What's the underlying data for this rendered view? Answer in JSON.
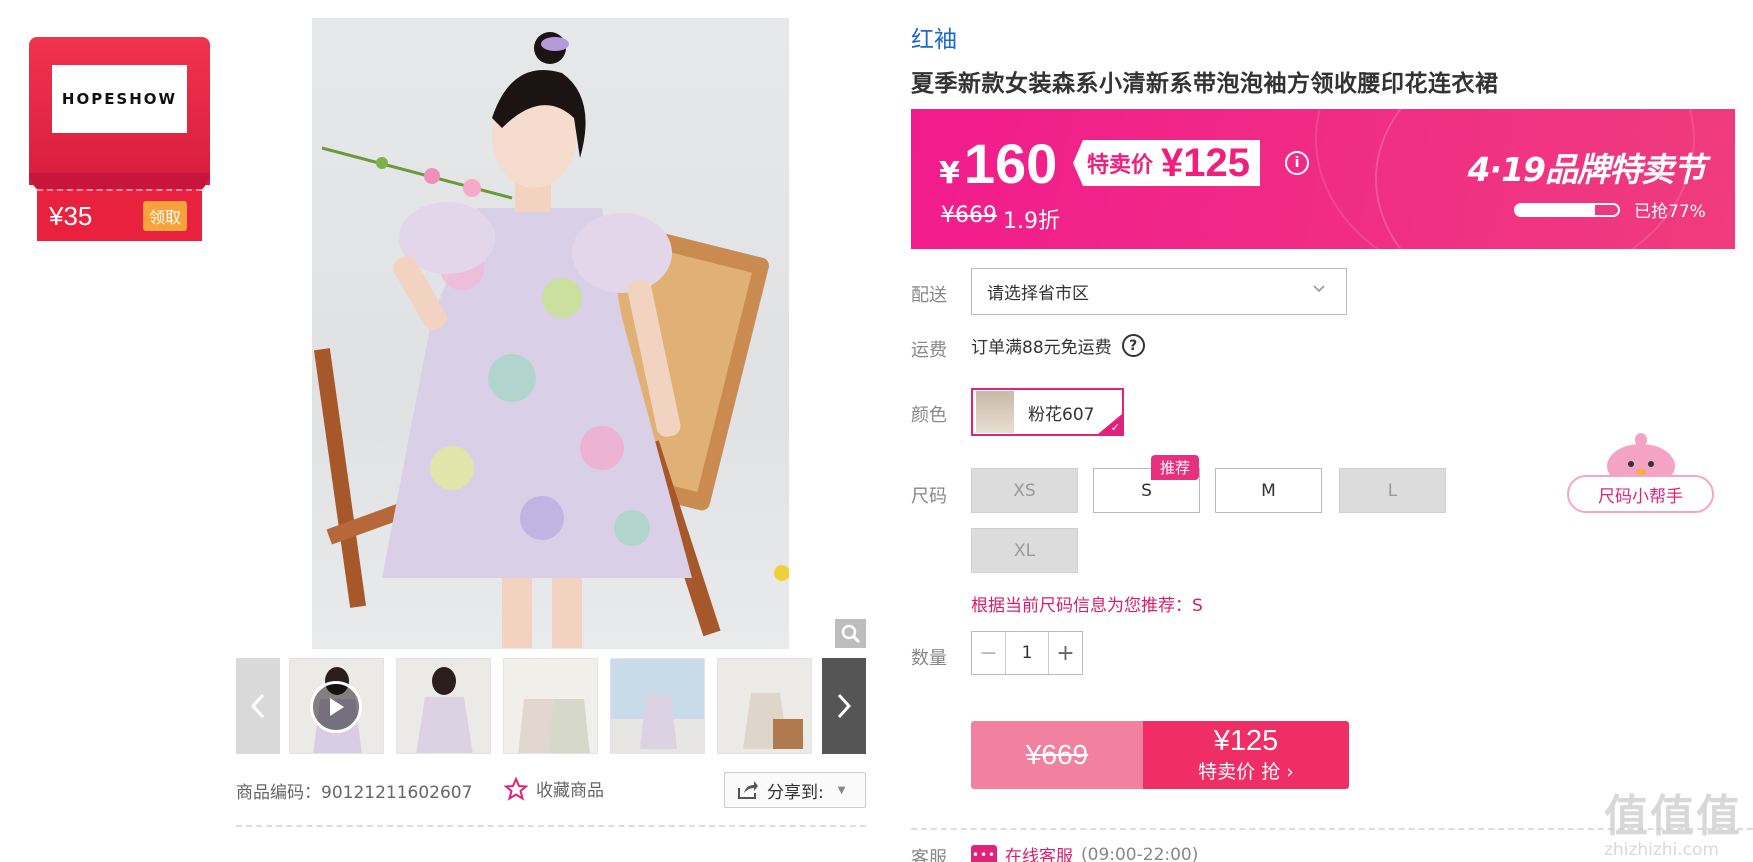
{
  "coupon": {
    "logo": "HOPESHOW",
    "amount": "¥35",
    "claim": "领取"
  },
  "gallery": {
    "sku_code": "商品编码：90121211602607",
    "favorite": "收藏商品",
    "share": "分享到:"
  },
  "product": {
    "brand": "红袖",
    "title": "夏季新款女装森系小清新系带泡泡袖方领收腰印花连衣裙"
  },
  "price": {
    "currency": "¥",
    "current": "160",
    "special_label": "特卖价",
    "special_value": "¥125",
    "original": "¥669",
    "discount": "1.9折",
    "festival": "4·19品牌特卖节",
    "sold_fraction": 0.77,
    "sold_text": "已抢77%"
  },
  "delivery": {
    "label": "配送",
    "placeholder": "请选择省市区"
  },
  "shipping": {
    "label": "运费",
    "text": "订单满88元免运费"
  },
  "color": {
    "label": "颜色",
    "selected": "粉花607"
  },
  "size": {
    "label": "尺码",
    "options": [
      {
        "label": "XS",
        "available": false
      },
      {
        "label": "S",
        "available": true
      },
      {
        "label": "M",
        "available": true
      },
      {
        "label": "L",
        "available": false
      },
      {
        "label": "XL",
        "available": false
      }
    ],
    "recommend_badge": "推荐",
    "helper": "尺码小帮手",
    "recommendation": "根据当前尺码信息为您推荐：S"
  },
  "quantity": {
    "label": "数量",
    "value": "1",
    "minus": "−",
    "plus": "+"
  },
  "buy": {
    "original": "¥669",
    "price": "¥125",
    "action": "特卖价 抢 ›"
  },
  "service": {
    "label": "客服",
    "link": "在线客服",
    "hours": "(09:00-22:00)"
  },
  "watermark": {
    "logo": "值值值",
    "site": "zhizhizhi.com"
  },
  "colors": {
    "accent": "#e0227a",
    "banner": "#f21b8d",
    "brand_link": "#1d68c8",
    "coupon": "#e8213f"
  }
}
